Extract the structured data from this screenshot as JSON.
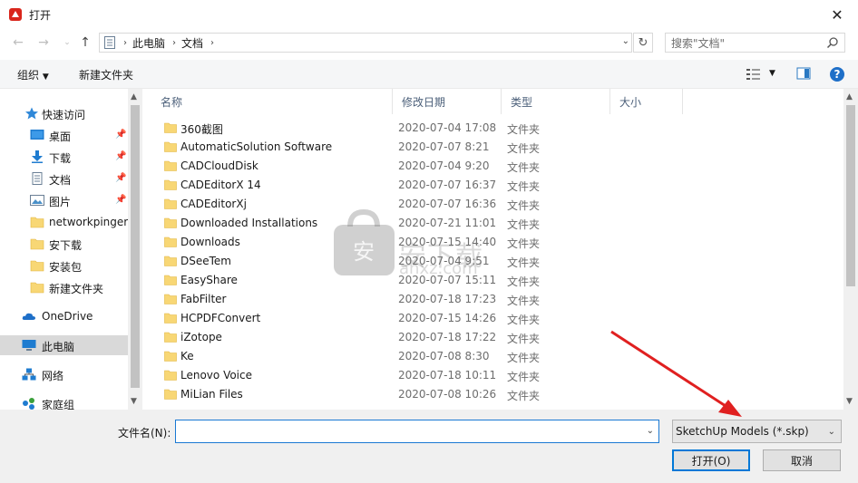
{
  "window": {
    "title": "打开"
  },
  "address": {
    "crumbs": [
      "此电脑",
      "文档"
    ]
  },
  "search": {
    "placeholder": "搜索\"文档\""
  },
  "toolbar": {
    "organize": "组织",
    "new_folder": "新建文件夹"
  },
  "sidebar": {
    "items": [
      {
        "label": "快速访问",
        "icon": "star-icon"
      },
      {
        "label": "桌面",
        "icon": "desktop-icon",
        "pinned": true
      },
      {
        "label": "下载",
        "icon": "download-icon",
        "pinned": true
      },
      {
        "label": "文档",
        "icon": "document-icon",
        "pinned": true
      },
      {
        "label": "图片",
        "icon": "picture-icon",
        "pinned": true
      },
      {
        "label": "networkpinger",
        "icon": "folder-icon"
      },
      {
        "label": "安下载",
        "icon": "folder-icon"
      },
      {
        "label": "安装包",
        "icon": "folder-icon"
      },
      {
        "label": "新建文件夹",
        "icon": "folder-icon"
      },
      {
        "label": "OneDrive",
        "icon": "cloud-icon"
      },
      {
        "label": "此电脑",
        "icon": "computer-icon",
        "selected": true
      },
      {
        "label": "网络",
        "icon": "network-icon"
      },
      {
        "label": "家庭组",
        "icon": "homegroup-icon"
      }
    ]
  },
  "columns": {
    "name": "名称",
    "date": "修改日期",
    "type": "类型",
    "size": "大小"
  },
  "files": [
    {
      "name": "360截图",
      "date": "2020-07-04 17:08",
      "type": "文件夹"
    },
    {
      "name": "AutomaticSolution Software",
      "date": "2020-07-07 8:21",
      "type": "文件夹"
    },
    {
      "name": "CADCloudDisk",
      "date": "2020-07-04 9:20",
      "type": "文件夹"
    },
    {
      "name": "CADEditorX 14",
      "date": "2020-07-07 16:37",
      "type": "文件夹"
    },
    {
      "name": "CADEditorXj",
      "date": "2020-07-07 16:36",
      "type": "文件夹"
    },
    {
      "name": "Downloaded Installations",
      "date": "2020-07-21 11:01",
      "type": "文件夹"
    },
    {
      "name": "Downloads",
      "date": "2020-07-15 14:40",
      "type": "文件夹"
    },
    {
      "name": "DSeeTem",
      "date": "2020-07-04 9:51",
      "type": "文件夹"
    },
    {
      "name": "EasyShare",
      "date": "2020-07-07 15:11",
      "type": "文件夹"
    },
    {
      "name": "FabFilter",
      "date": "2020-07-18 17:23",
      "type": "文件夹"
    },
    {
      "name": "HCPDFConvert",
      "date": "2020-07-15 14:26",
      "type": "文件夹"
    },
    {
      "name": "iZotope",
      "date": "2020-07-18 17:22",
      "type": "文件夹"
    },
    {
      "name": "Ke",
      "date": "2020-07-08 8:30",
      "type": "文件夹"
    },
    {
      "name": "Lenovo Voice",
      "date": "2020-07-18 10:11",
      "type": "文件夹"
    },
    {
      "name": "MiLian Files",
      "date": "2020-07-08 10:26",
      "type": "文件夹"
    }
  ],
  "watermark": {
    "text": "安下载",
    "url": "anxz.com"
  },
  "bottom": {
    "filename_label": "文件名(N):",
    "filename_value": "",
    "filetype": "SketchUp Models (*.skp)",
    "open_button": "打开(O)",
    "cancel_button": "取消"
  },
  "colors": {
    "accent": "#0078d7",
    "arrow": "#e02020",
    "folder": "#f8d775"
  }
}
